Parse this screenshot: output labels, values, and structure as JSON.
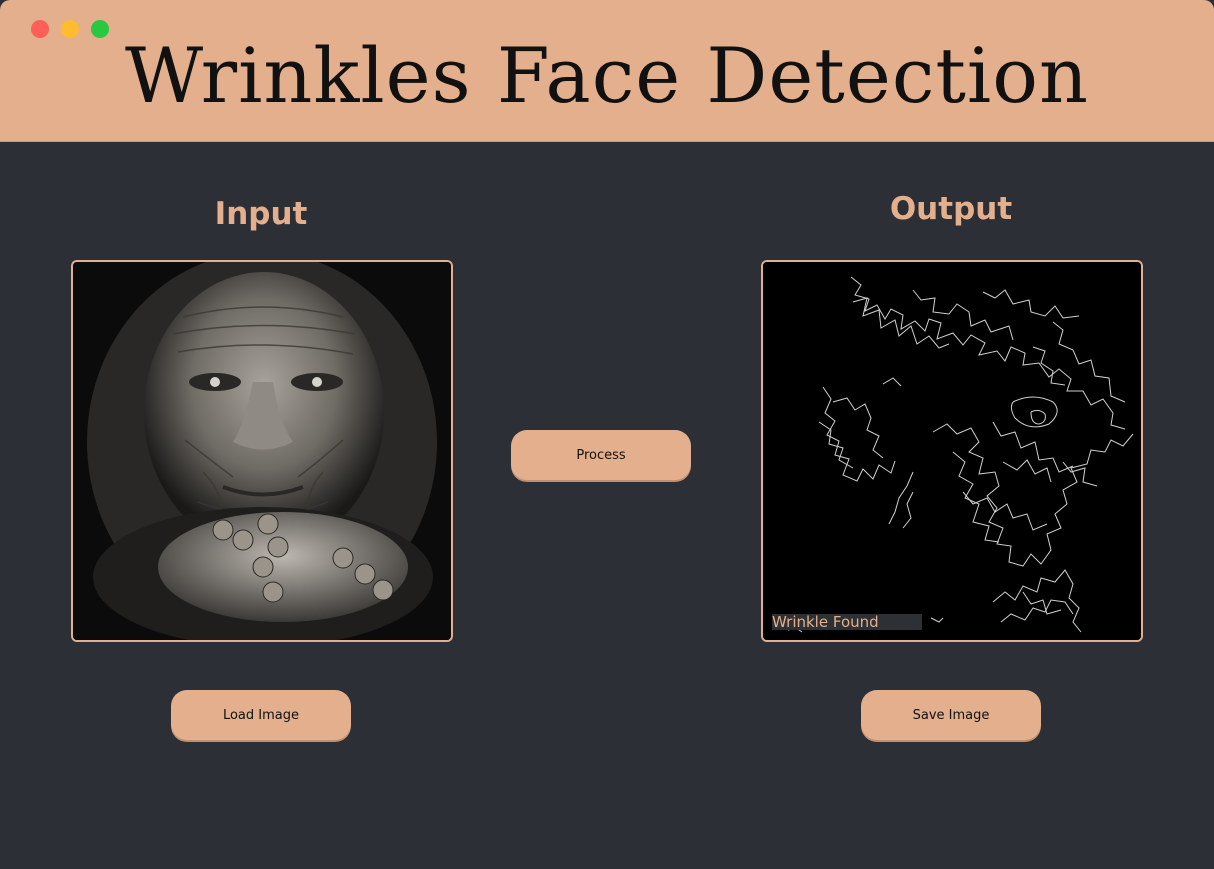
{
  "window": {
    "title": "Wrinkles Face Detection",
    "controls": [
      "close",
      "minimize",
      "maximize"
    ]
  },
  "input_panel": {
    "label": "Input",
    "image_alt": "Input portrait photo of elderly woman with clasped hands",
    "load_button": "Load Image"
  },
  "process_button": "Process",
  "output_panel": {
    "label": "Output",
    "image_alt": "Wrinkle edge detection result",
    "result_text": "Wrinkle Found",
    "save_button": "Save Image"
  },
  "colors": {
    "accent": "#e3af8c",
    "background": "#2d2f37",
    "text_dark": "#111111"
  }
}
